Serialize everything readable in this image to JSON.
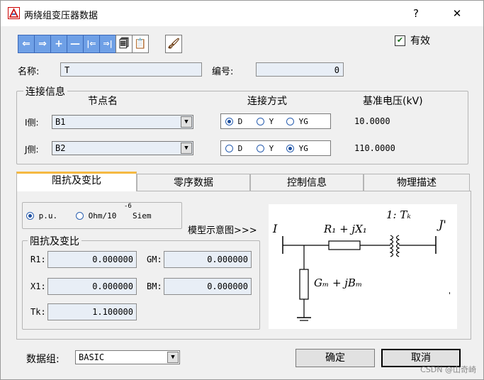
{
  "window": {
    "title": "两绕组变压器数据",
    "help_glyph": "?",
    "close_glyph": "✕"
  },
  "toolbar": {
    "icons": [
      "arrow-left",
      "arrow-right",
      "plus",
      "minus",
      "first",
      "last",
      "copy",
      "paste",
      "brush"
    ],
    "glyphs": {
      "prev": "⇐",
      "next": "⇒",
      "add": "+",
      "remove": "—",
      "first": "|⇐",
      "last": "⇒|",
      "copy": "🗐",
      "paste": "📋",
      "brush": "🖌"
    },
    "color": "#6fa0e6"
  },
  "valid": {
    "label": "有效",
    "checked": true,
    "mark": "✔"
  },
  "name": {
    "label": "名称:",
    "value": "T"
  },
  "number": {
    "label": "编号:",
    "value": "0"
  },
  "connection": {
    "title": "连接信息",
    "headers": {
      "node": "节点名",
      "mode": "连接方式",
      "voltage": "基准电压(kV)"
    },
    "sides": [
      {
        "label": "I侧:",
        "node": "B1",
        "options": [
          "D",
          "Y",
          "YG"
        ],
        "selected": "D",
        "voltage": "10.0000"
      },
      {
        "label": "J侧:",
        "node": "B2",
        "options": [
          "D",
          "Y",
          "YG"
        ],
        "selected": "YG",
        "voltage": "110.0000"
      }
    ]
  },
  "tabs": [
    "阻抗及变比",
    "零序数据",
    "控制信息",
    "物理描述"
  ],
  "active_tab": "阻抗及变比",
  "units": {
    "pu": "p.u.",
    "ohm": "Ohm/10",
    "exp": "-6",
    "siem": "Siem",
    "selected": "p.u."
  },
  "impedance": {
    "title": "阻抗及变比",
    "R1": {
      "label": "R1:",
      "value": "0.000000"
    },
    "X1": {
      "label": "X1:",
      "value": "0.000000"
    },
    "Tk": {
      "label": "Tk:",
      "value": "1.100000"
    },
    "GM": {
      "label": "GM:",
      "value": "0.000000"
    },
    "BM": {
      "label": "BM:",
      "value": "0.000000"
    }
  },
  "model_link": "模型示意图>>>",
  "diagram": {
    "I": "I",
    "J": "J'",
    "series": "R₁ + jX₁",
    "ratio": "1: Tₖ",
    "shunt": "Gₘ + jBₘ",
    "dot": "'"
  },
  "dataset": {
    "label": "数据组:",
    "value": "BASIC"
  },
  "buttons": {
    "ok": "确定",
    "cancel": "取消"
  },
  "watermark": "CSDN @山奇崎"
}
